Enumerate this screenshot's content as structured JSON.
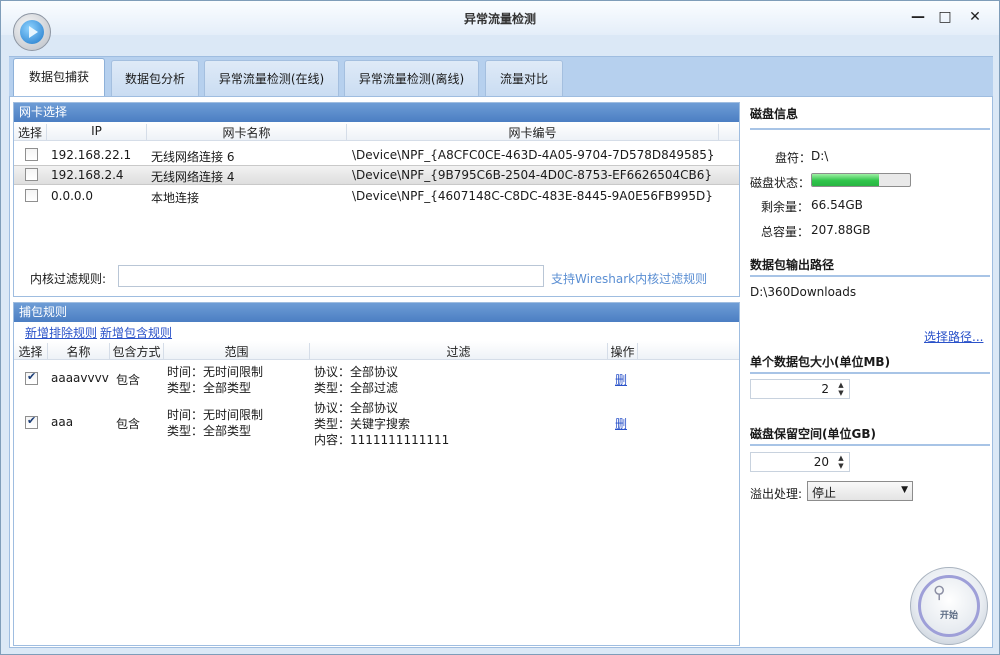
{
  "window": {
    "title": "异常流量检测",
    "minimize": "—",
    "maximize": "□",
    "close": "✕"
  },
  "tabs": [
    "数据包捕获",
    "数据包分析",
    "异常流量检测(在线)",
    "异常流量检测(离线)",
    "流量对比"
  ],
  "nic": {
    "title": "网卡选择",
    "columns": [
      "选择",
      "IP",
      "网卡名称",
      "网卡编号"
    ],
    "rows": [
      {
        "checked": false,
        "ip": "192.168.22.1",
        "name": "无线网络连接 6",
        "id": "\\Device\\NPF_{A8CFC0CE-463D-4A05-9704-7D578D849585}"
      },
      {
        "checked": false,
        "ip": "192.168.2.4",
        "name": "无线网络连接 4",
        "id": "\\Device\\NPF_{9B795C6B-2504-4D0C-8753-EF6626504CB6}"
      },
      {
        "checked": false,
        "ip": "0.0.0.0",
        "name": "本地连接",
        "id": "\\Device\\NPF_{4607148C-C8DC-483E-8445-9A0E56FB995D}"
      }
    ],
    "filter_label": "内核过滤规则:",
    "filter_value": "",
    "filter_hint": "支持Wireshark内核过滤规则"
  },
  "rules": {
    "title": "捕包规则",
    "add_exclude": "新增排除规则",
    "add_include": "新增包含规则",
    "columns": [
      "选择",
      "名称",
      "包含方式",
      "范围",
      "过滤",
      "操作"
    ],
    "rows": [
      {
        "checked": true,
        "name": "aaaavvvv",
        "mode": "包含",
        "range": [
          "时间：无时间限制",
          "类型：全部类型"
        ],
        "filter": [
          "协议：全部协议",
          "类型：全部过滤"
        ],
        "op": "删"
      },
      {
        "checked": true,
        "name": "aaa",
        "mode": "包含",
        "range": [
          "时间：无时间限制",
          "类型：全部类型"
        ],
        "filter": [
          "协议：全部协议",
          "类型：关键字搜索",
          "内容：1111111111111"
        ],
        "op": "删"
      }
    ]
  },
  "disk": {
    "title": "磁盘信息",
    "drive_label": "盘符：",
    "drive": "D:\\",
    "status_label": "磁盘状态：",
    "usage_fraction": 0.68,
    "free_label": "剩余量：",
    "free": "66.54GB",
    "total_label": "总容量：",
    "total": "207.88GB"
  },
  "output": {
    "title": "数据包输出路径",
    "path": "D:\\360Downloads",
    "choose": "选择路径..."
  },
  "packet_size": {
    "title": "单个数据包大小(单位MB)",
    "value": "2"
  },
  "reserve": {
    "title": "磁盘保留空间(单位GB)",
    "value": "20",
    "overflow_label": "溢出处理:",
    "overflow_value": "停止"
  },
  "start": {
    "label": "开始"
  }
}
